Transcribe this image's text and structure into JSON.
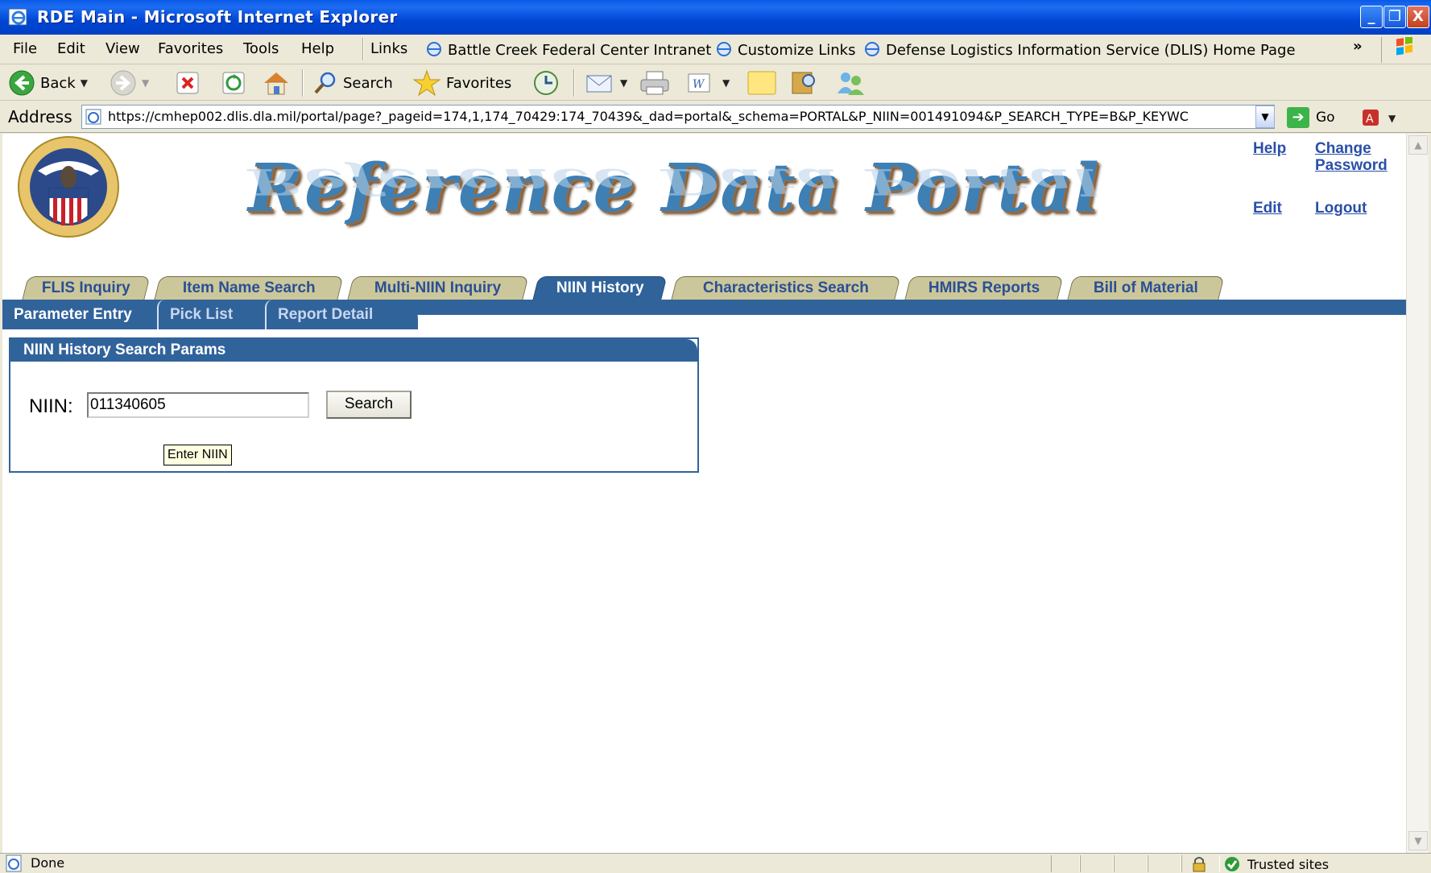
{
  "window": {
    "title": "RDE Main - Microsoft Internet Explorer",
    "minimize": "_",
    "restore": "❐",
    "close": "X"
  },
  "menu": {
    "items": [
      "File",
      "Edit",
      "View",
      "Favorites",
      "Tools",
      "Help"
    ],
    "links_label": "Links",
    "links": [
      "Battle Creek Federal Center Intranet",
      "Customize Links",
      "Defense Logistics Information Service (DLIS) Home Page"
    ],
    "more": "»"
  },
  "toolbar": {
    "back": "Back",
    "search": "Search",
    "favorites": "Favorites"
  },
  "address": {
    "label": "Address",
    "url": "https://cmhep002.dlis.dla.mil/portal/page?_pageid=174,1,174_70429:174_70439&_dad=portal&_schema=PORTAL&P_NIIN=001491094&P_SEARCH_TYPE=B&P_KEYWC",
    "go": "Go"
  },
  "header": {
    "banner": "Reference Data Portal",
    "links": {
      "help": "Help",
      "change": "Change",
      "password": "Password",
      "edit": "Edit",
      "logout": "Logout"
    }
  },
  "tabs": [
    {
      "label": "FLIS Inquiry",
      "active": false
    },
    {
      "label": "Item Name Search",
      "active": false
    },
    {
      "label": "Multi-NIIN Inquiry",
      "active": false
    },
    {
      "label": "NIIN History",
      "active": true
    },
    {
      "label": "Characteristics Search",
      "active": false
    },
    {
      "label": "HMIRS Reports",
      "active": false
    },
    {
      "label": "Bill of Material",
      "active": false
    }
  ],
  "subtabs": [
    {
      "label": "Parameter Entry",
      "active": true
    },
    {
      "label": "Pick List",
      "active": false
    },
    {
      "label": "Report Detail",
      "active": false
    }
  ],
  "panel": {
    "title": "NIIN History Search Params",
    "niin_label": "NIIN:",
    "niin_value": "011340605",
    "search_button": "Search",
    "tooltip": "Enter NIIN"
  },
  "status": {
    "text": "Done",
    "zone": "Trusted sites"
  },
  "colors": {
    "accent": "#31639b",
    "tab_inactive": "#ccc79a",
    "link": "#2a4fa8"
  }
}
